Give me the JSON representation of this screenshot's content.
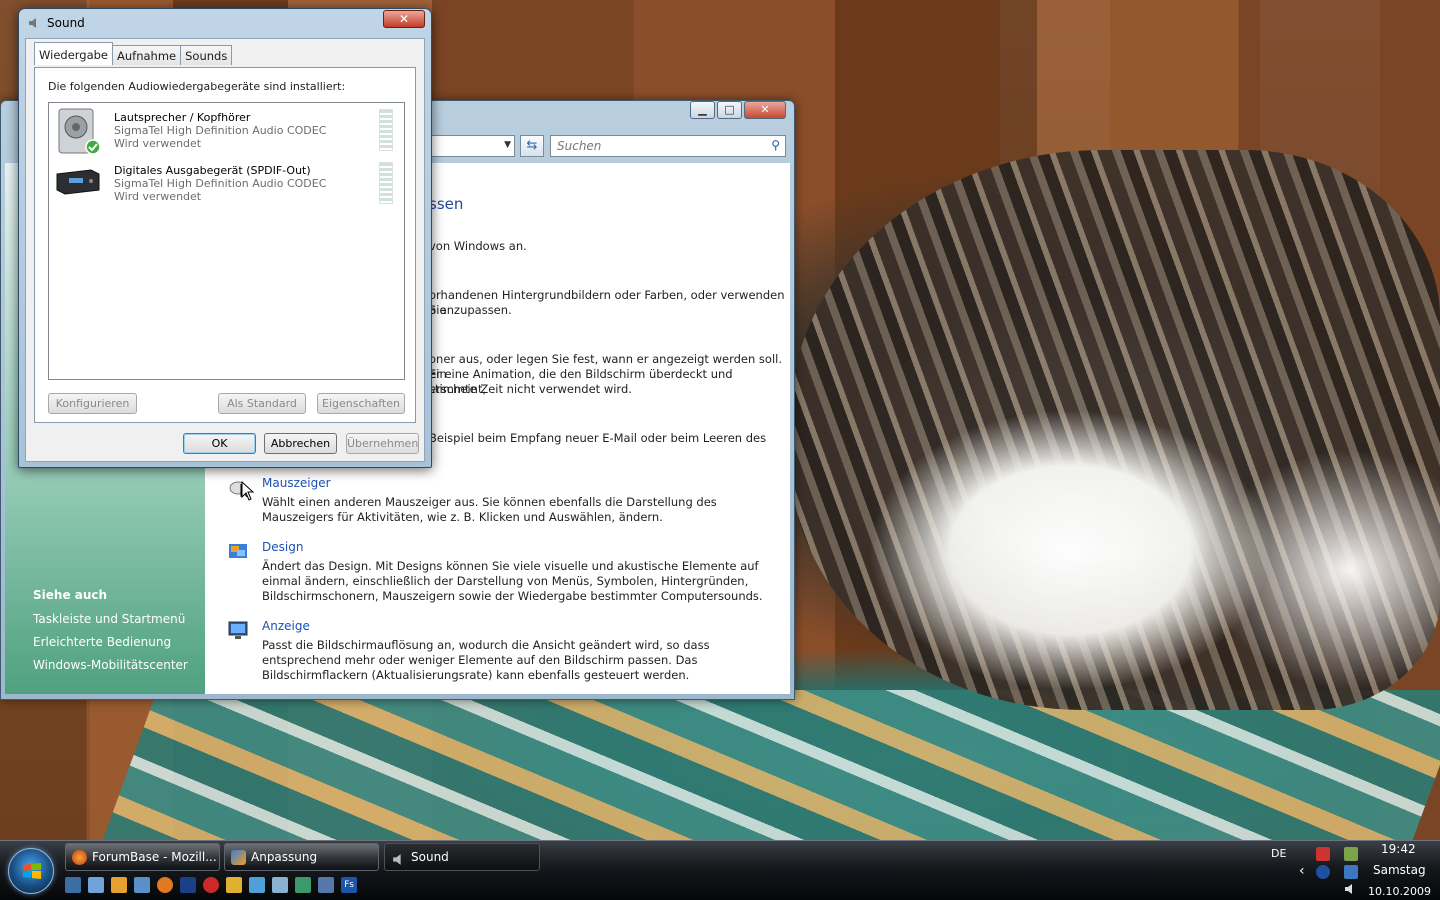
{
  "sound_dialog": {
    "title": "Sound",
    "close": "✕",
    "tabs": [
      "Wiedergabe",
      "Aufnahme",
      "Sounds"
    ],
    "intro": "Die folgenden Audiowiedergabegeräte sind installiert:",
    "devices": [
      {
        "name": "Lautsprecher / Kopfhörer",
        "driver": "SigmaTel High Definition Audio CODEC",
        "status": "Wird verwendet",
        "icon": "speaker-icon",
        "default": true
      },
      {
        "name": "Digitales Ausgabegerät (SPDIF-Out)",
        "driver": "SigmaTel High Definition Audio CODEC",
        "status": "Wird verwendet",
        "icon": "digital-output-icon",
        "default": false
      }
    ],
    "buttons": {
      "configure": "Konfigurieren",
      "set_default": "Als Standard",
      "properties": "Eigenschaften",
      "ok": "OK",
      "cancel": "Abbrechen",
      "apply": "Übernehmen"
    }
  },
  "personalize_window": {
    "search_placeholder": "Suchen",
    "heading_fragment": "ssen",
    "caption": {
      "min": "▁",
      "max": "□",
      "close": "✕"
    },
    "fragments": {
      "f1": "von Windows an.",
      "f2": "orhandenen Hintergrundbildern oder Farben, oder verwenden Sie",
      "f3": "o anzupassen.",
      "f4": "oner aus, oder legen Sie fest, wann er angezeigt werden soll. Ein",
      "f5": "er eine Animation, die den Bildschirm überdeckt und erscheint,",
      "f6": "stimmte Zeit nicht verwendet wird.",
      "f7": "Beispiel beim Empfang neuer E-Mail oder beim Leeren des"
    },
    "items": [
      {
        "link": "Mauszeiger",
        "desc": "Wählt einen anderen Mauszeiger aus. Sie können ebenfalls die Darstellung des Mauszeigers für Aktivitäten, wie z. B. Klicken und Auswählen, ändern."
      },
      {
        "link": "Design",
        "desc": "Ändert das Design. Mit Designs können Sie viele visuelle und akustische Elemente auf einmal ändern, einschließlich der Darstellung von Menüs, Symbolen, Hintergründen, Bildschirmschonern, Mauszeigern sowie der Wiedergabe bestimmter Computersounds."
      },
      {
        "link": "Anzeige",
        "desc": "Passt die Bildschirmauflösung an, wodurch die Ansicht geändert wird, so dass entsprechend mehr oder weniger Elemente auf den Bildschirm passen. Das Bildschirmflackern (Aktualisierungsrate) kann ebenfalls gesteuert werden."
      }
    ],
    "see_also": {
      "heading": "Siehe auch",
      "links": [
        "Taskleiste und Startmenü",
        "Erleichterte Bedienung",
        "Windows-Mobilitätscenter"
      ]
    }
  },
  "taskbar": {
    "buttons": [
      "ForumBase - Mozill...",
      "Anpassung",
      "Sound"
    ],
    "language": "DE",
    "time": "19:42",
    "weekday": "Samstag",
    "date": "10.10.2009",
    "tray_arrow": "‹"
  },
  "colors": {
    "link": "#1e50b4",
    "taskbar": "#15181c",
    "dialog_frame": "#a8c2d7"
  }
}
